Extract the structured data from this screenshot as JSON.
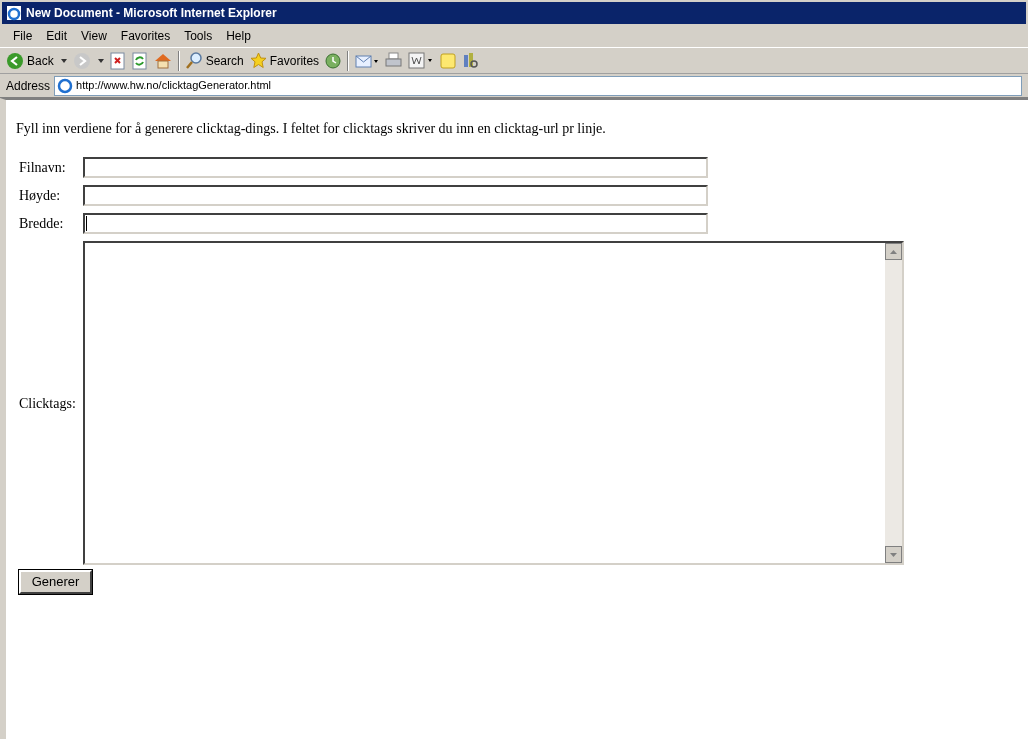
{
  "window": {
    "title": "New Document - Microsoft Internet Explorer"
  },
  "menu": [
    "File",
    "Edit",
    "View",
    "Favorites",
    "Tools",
    "Help"
  ],
  "toolbar": [
    {
      "kind": "back",
      "label": "Back"
    },
    {
      "kind": "forward"
    },
    {
      "kind": "stop"
    },
    {
      "kind": "refresh"
    },
    {
      "kind": "home"
    },
    {
      "kind": "sep"
    },
    {
      "kind": "search",
      "label": "Search"
    },
    {
      "kind": "favorites",
      "label": "Favorites"
    },
    {
      "kind": "history"
    },
    {
      "kind": "sep"
    },
    {
      "kind": "mail"
    },
    {
      "kind": "print"
    },
    {
      "kind": "edit"
    },
    {
      "kind": "note"
    },
    {
      "kind": "research"
    }
  ],
  "address": {
    "label": "Address",
    "url": "http://www.hw.no/clicktagGenerator.html"
  },
  "page": {
    "intro": "Fyll inn verdiene for å generere clicktag-dings. I feltet for clicktags skriver du inn en clicktag-url pr linje.",
    "fields": [
      {
        "label": "Filnavn:",
        "focused": false
      },
      {
        "label": "Høyde:",
        "focused": false
      },
      {
        "label": "Bredde:",
        "focused": true
      }
    ],
    "textarea": {
      "label": "Clicktags:"
    },
    "button": "Generer"
  }
}
